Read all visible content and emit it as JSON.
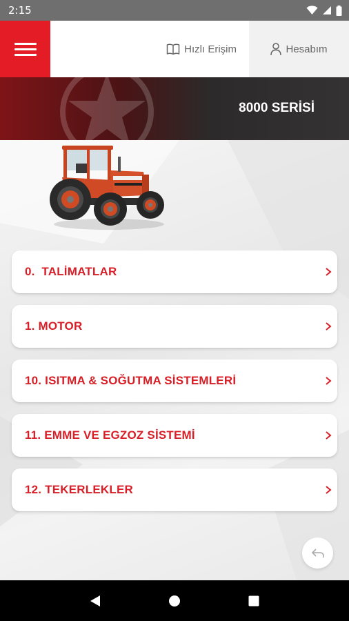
{
  "status_bar": {
    "time": "2:15",
    "icons": [
      "wifi-icon",
      "signal-icon",
      "battery-icon"
    ]
  },
  "header": {
    "menu_icon": "hamburger-icon",
    "quick_access_label": "Hızlı Erişim",
    "quick_access_icon": "book-icon",
    "account_label": "Hesabım",
    "account_icon": "user-icon"
  },
  "banner": {
    "title": "8000 SERİSİ"
  },
  "menu": {
    "items": [
      {
        "label": "0.  TALİMATLAR"
      },
      {
        "label": "1. MOTOR"
      },
      {
        "label": "10. ISITMA & SOĞUTMA SİSTEMLERİ"
      },
      {
        "label": "11. EMME VE EGZOZ SİSTEMİ"
      },
      {
        "label": "12. TEKERLEKLER"
      }
    ]
  },
  "colors": {
    "brand_red": "#e31c25",
    "label_red": "#d81e27"
  },
  "nav": {
    "icons": [
      "back-icon",
      "home-icon",
      "recents-icon"
    ]
  }
}
